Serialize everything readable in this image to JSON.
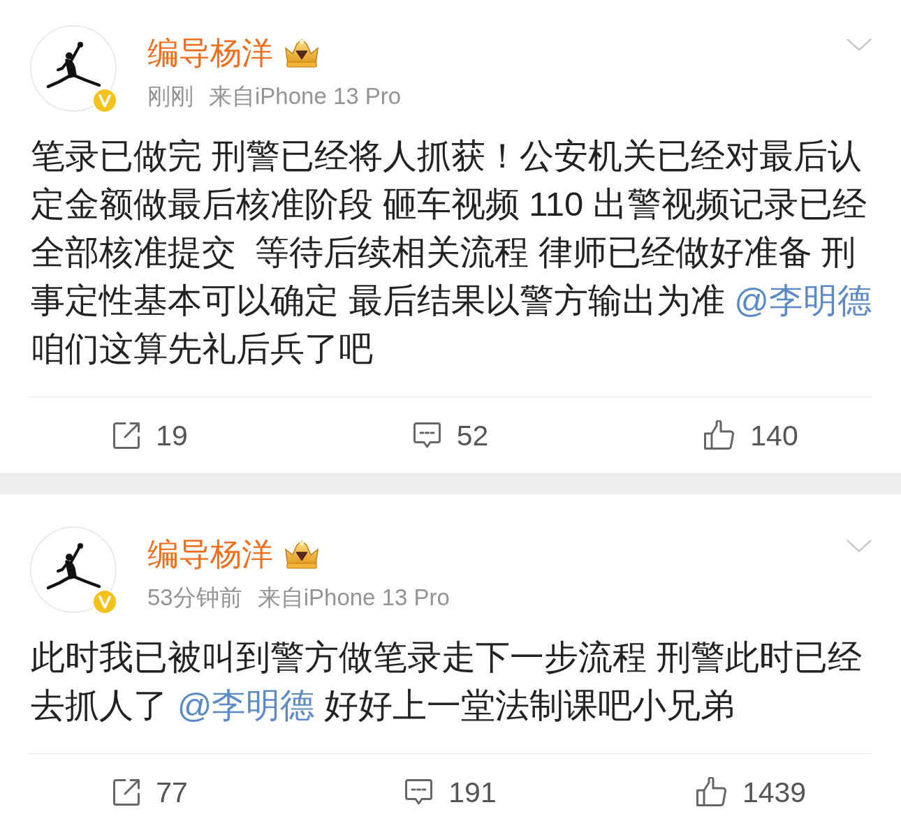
{
  "posts": [
    {
      "author": {
        "name": "编导杨洋",
        "verified": true
      },
      "time": "刚刚",
      "source": "来自iPhone 13 Pro",
      "content": [
        {
          "kind": "text",
          "text": "笔录已做完 刑警已经将人抓获！公安机关已经对最后认定金额做最后核准阶段 砸车视频 110 出警视频记录已经全部核准提交  等待后续相关流程 律师已经做好准备 刑事定性基本可以确定 最后结果以警方输出为准 "
        },
        {
          "kind": "mention",
          "text": "@李明德"
        },
        {
          "kind": "text",
          "text": " 咱们这算先礼后兵了吧"
        }
      ],
      "reposts": "19",
      "comments": "52",
      "likes": "140"
    },
    {
      "author": {
        "name": "编导杨洋",
        "verified": true
      },
      "time": "53分钟前",
      "source": "来自iPhone 13 Pro",
      "content": [
        {
          "kind": "text",
          "text": "此时我已被叫到警方做笔录走下一步流程 刑警此时已经去抓人了 "
        },
        {
          "kind": "mention",
          "text": "@李明德"
        },
        {
          "kind": "text",
          "text": " 好好上一堂法制课吧小兄弟"
        }
      ],
      "reposts": "77",
      "comments": "191",
      "likes": "1439"
    }
  ]
}
